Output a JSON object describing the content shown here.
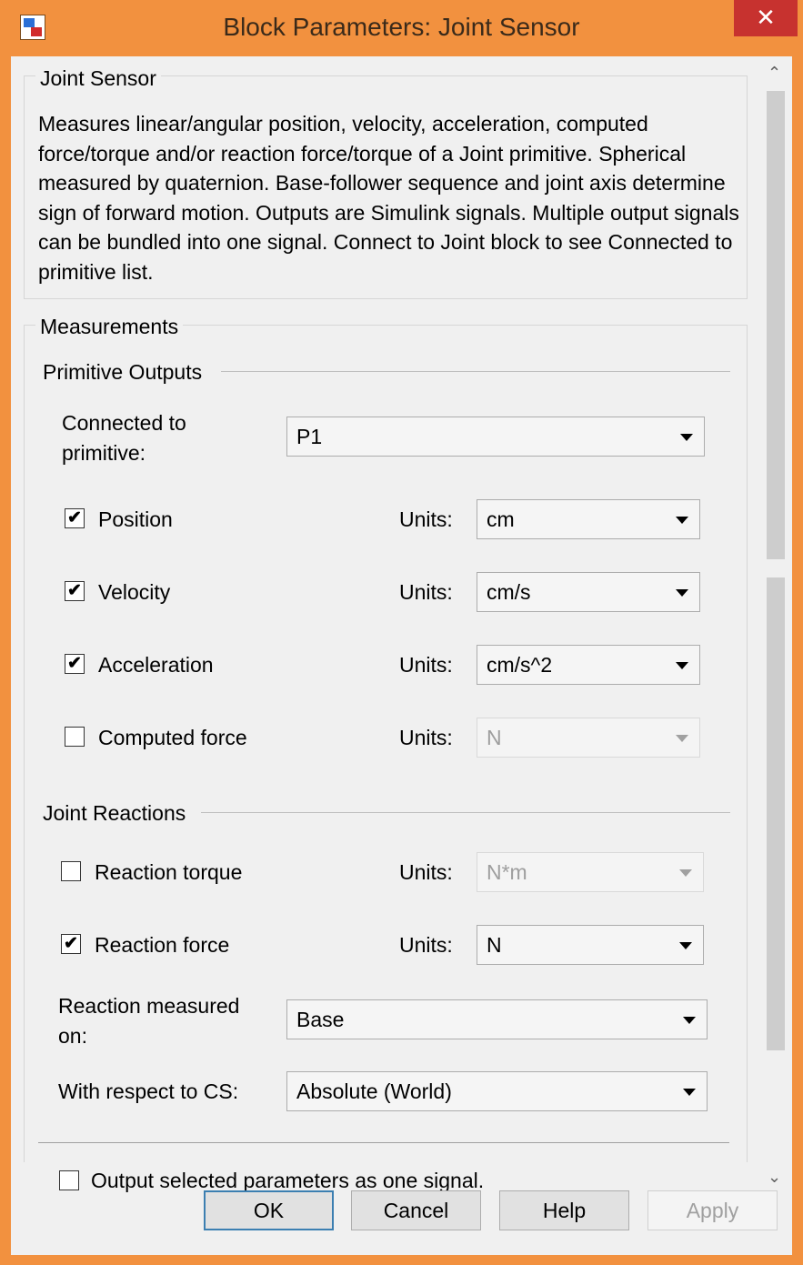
{
  "window": {
    "title": "Block Parameters: Joint Sensor",
    "icon": "simulink-block-icon",
    "close_glyph": "✕"
  },
  "description_group": {
    "title": "Joint Sensor",
    "text": "Measures linear/angular position, velocity, acceleration, computed force/torque and/or reaction force/torque of a Joint primitive. Spherical measured by quaternion. Base-follower sequence and joint axis determine sign of forward motion. Outputs are Simulink signals. Multiple output signals can be bundled into one signal. Connect to Joint block to see Connected to primitive list."
  },
  "measurements": {
    "title": "Measurements",
    "primitive_outputs": {
      "title": "Primitive Outputs",
      "connected_label_1": "Connected to",
      "connected_label_2": "primitive:",
      "connected_value": "P1",
      "rows": [
        {
          "label": "Position",
          "checked": true,
          "units_label": "Units:",
          "units": "cm",
          "enabled": true
        },
        {
          "label": "Velocity",
          "checked": true,
          "units_label": "Units:",
          "units": "cm/s",
          "enabled": true
        },
        {
          "label": "Acceleration",
          "checked": true,
          "units_label": "Units:",
          "units": "cm/s^2",
          "enabled": true
        },
        {
          "label": "Computed force",
          "checked": false,
          "units_label": "Units:",
          "units": "N",
          "enabled": false
        }
      ]
    },
    "joint_reactions": {
      "title": "Joint Reactions",
      "rows": [
        {
          "label": "Reaction torque",
          "checked": false,
          "units_label": "Units:",
          "units": "N*m",
          "enabled": false
        },
        {
          "label": "Reaction force",
          "checked": true,
          "units_label": "Units:",
          "units": "N",
          "enabled": true
        }
      ],
      "measured_on_label_1": "Reaction measured",
      "measured_on_label_2": "on:",
      "measured_on_value": "Base",
      "wrt_label": "With respect to CS:",
      "wrt_value": "Absolute (World)"
    },
    "one_signal": {
      "label": "Output selected parameters as one signal.",
      "checked": false
    }
  },
  "buttons": {
    "ok": "OK",
    "cancel": "Cancel",
    "help": "Help",
    "apply": "Apply"
  },
  "check_glyph": "✔",
  "colors": {
    "frame": "#f2913f",
    "close": "#c7322f",
    "default_button_border": "#3c7fb1"
  }
}
